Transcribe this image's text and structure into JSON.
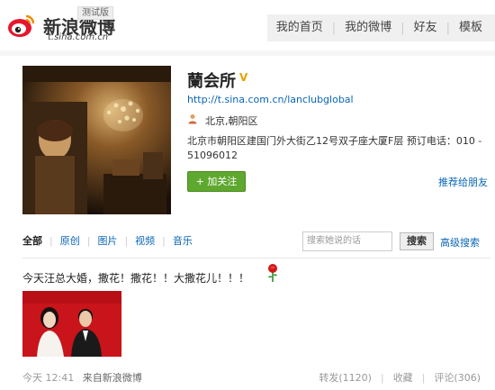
{
  "header": {
    "logo_text": "新浪微博",
    "logo_domain": "t.sina.com.cn",
    "beta_label": "测试版",
    "nav": [
      "我的首页",
      "我的微博",
      "好友",
      "模板"
    ]
  },
  "profile": {
    "name": "蘭会所",
    "verified_mark": "V",
    "url": "http://t.sina.com.cn/lanclubglobal",
    "location": "北京,朝阳区",
    "address": "北京市朝阳区建国门外大街乙12号双子座大厦F层 预订电话：010 - 51096012",
    "follow_label": "+ 加关注",
    "recommend_label": "推荐给朋友"
  },
  "filter_tabs": [
    "全部",
    "原创",
    "图片",
    "视频",
    "音乐"
  ],
  "search": {
    "placeholder": "搜索她说的话",
    "button_label": "搜索",
    "advanced_label": "高级搜索"
  },
  "post": {
    "text": "今天汪总大婚，撒花！撒花！！大撒花儿！！！",
    "time": "今天 12:41",
    "source": "来自新浪微博",
    "repost": "转发(1120)",
    "favorite": "收藏",
    "comment": "评论(306)"
  },
  "colors": {
    "link": "#0a66b6",
    "follow_button": "#5fa82f",
    "verified": "#e8a200",
    "logo_red": "#e6162d"
  }
}
